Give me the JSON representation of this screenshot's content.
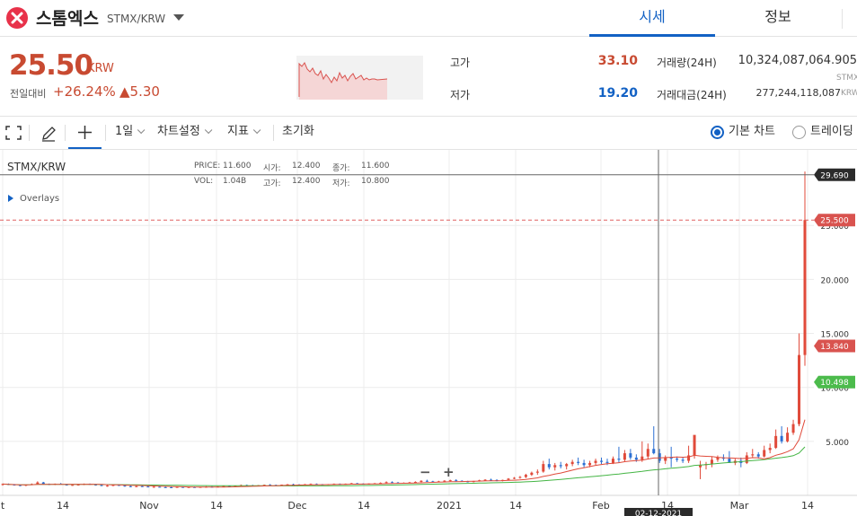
{
  "header": {
    "coin_name": "스톰엑스",
    "pair": "STMX/KRW",
    "logo_icon": "stormx-x-logo",
    "tabs": [
      {
        "label": "시세",
        "active": true
      },
      {
        "label": "정보",
        "active": false
      }
    ]
  },
  "ticker": {
    "price": "25.50",
    "unit": "KRW",
    "change_label": "전일대비",
    "change_rate": "+26.24%",
    "change_amount": "▲5.30",
    "high_label": "고가",
    "high": "33.10",
    "low_label": "저가",
    "low": "19.20",
    "volume_label": "거래량(24H)",
    "volume": "10,324,087,064.905",
    "volume_unit": "STMX",
    "value_label": "거래대금(24H)",
    "value": "277,244,118,087",
    "value_unit": "KRW",
    "up_color": "#c84a31",
    "down_color": "#1261c4"
  },
  "toolbar": {
    "period": "1일",
    "chart_settings": "차트설정",
    "indicators": "지표",
    "reset": "초기화",
    "basic_chart": "기본 차트",
    "trading_view": "트레이딩"
  },
  "legend": {
    "pair": "STMX/KRW",
    "overlays": "Overlays",
    "price_label": "PRICE:",
    "price": "11.600",
    "open_label": "시가:",
    "open": "12.400",
    "close_label": "종가:",
    "close": "11.600",
    "vol_label": "VOL:",
    "vol": "1.04B",
    "high_label": "고가:",
    "high": "12.400",
    "low_label": "저가:",
    "low": "10.800"
  },
  "chart_data": {
    "type": "candlestick",
    "x_ticks": [
      "t",
      "14",
      "Nov",
      "14",
      "Dec",
      "14",
      "2021",
      "14",
      "Feb",
      "14",
      "Mar",
      "14"
    ],
    "y_ticks": [
      "5.000",
      "10.000",
      "15.000",
      "20.000",
      "25.000"
    ],
    "y_range": [
      0,
      32
    ],
    "crosshair_price": "29.690",
    "crosshair_date": "02-12-2021",
    "last_price": "25.500",
    "ma_short_value": "13.840",
    "ma_long_value": "10.498",
    "ma_short_color": "#e04a3a",
    "ma_long_color": "#44b544",
    "up_color": "#e04a3a",
    "down_color": "#2b6fd3",
    "candles": [
      [
        1.0,
        1.1,
        0.9,
        1.05
      ],
      [
        1.05,
        1.1,
        0.95,
        1.0
      ],
      [
        1.0,
        1.05,
        0.9,
        0.95
      ],
      [
        0.95,
        1.0,
        0.85,
        0.9
      ],
      [
        0.9,
        1.0,
        0.85,
        0.98
      ],
      [
        0.98,
        1.1,
        0.95,
        1.05
      ],
      [
        1.05,
        1.3,
        1.0,
        1.2
      ],
      [
        1.2,
        1.25,
        1.0,
        1.05
      ],
      [
        1.05,
        1.1,
        0.95,
        1.0
      ],
      [
        1.0,
        1.1,
        0.95,
        1.08
      ],
      [
        1.08,
        1.15,
        1.0,
        1.02
      ],
      [
        1.02,
        1.05,
        0.9,
        0.92
      ],
      [
        0.92,
        1.0,
        0.88,
        0.97
      ],
      [
        0.97,
        1.05,
        0.9,
        1.0
      ],
      [
        1.0,
        1.1,
        0.95,
        1.06
      ],
      [
        1.06,
        1.1,
        0.98,
        1.0
      ],
      [
        1.0,
        1.05,
        0.9,
        0.95
      ],
      [
        0.95,
        1.0,
        0.85,
        0.88
      ],
      [
        0.88,
        0.95,
        0.8,
        0.9
      ],
      [
        0.9,
        1.0,
        0.85,
        0.96
      ],
      [
        0.96,
        1.0,
        0.88,
        0.9
      ],
      [
        0.9,
        0.95,
        0.8,
        0.85
      ],
      [
        0.85,
        0.9,
        0.75,
        0.8
      ],
      [
        0.8,
        0.88,
        0.75,
        0.85
      ],
      [
        0.85,
        0.9,
        0.78,
        0.82
      ],
      [
        0.82,
        0.88,
        0.75,
        0.78
      ],
      [
        0.78,
        0.85,
        0.7,
        0.8
      ],
      [
        0.8,
        0.86,
        0.74,
        0.76
      ],
      [
        0.76,
        0.82,
        0.7,
        0.75
      ],
      [
        0.75,
        0.8,
        0.68,
        0.72
      ],
      [
        0.72,
        0.8,
        0.7,
        0.78
      ],
      [
        0.78,
        0.82,
        0.7,
        0.74
      ],
      [
        0.74,
        0.8,
        0.7,
        0.77
      ],
      [
        0.77,
        0.82,
        0.72,
        0.75
      ],
      [
        0.75,
        0.8,
        0.7,
        0.78
      ],
      [
        0.78,
        0.85,
        0.74,
        0.8
      ],
      [
        0.8,
        0.86,
        0.76,
        0.78
      ],
      [
        0.78,
        0.84,
        0.74,
        0.82
      ],
      [
        0.82,
        0.9,
        0.8,
        0.86
      ],
      [
        0.86,
        0.9,
        0.8,
        0.84
      ],
      [
        0.84,
        0.9,
        0.8,
        0.88
      ],
      [
        0.88,
        1.0,
        0.85,
        0.95
      ],
      [
        0.95,
        1.0,
        0.88,
        0.92
      ],
      [
        0.92,
        0.98,
        0.86,
        0.9
      ],
      [
        0.9,
        0.96,
        0.85,
        0.94
      ],
      [
        0.94,
        1.0,
        0.9,
        0.98
      ],
      [
        0.98,
        1.05,
        0.92,
        0.96
      ],
      [
        0.96,
        1.0,
        0.9,
        0.94
      ],
      [
        0.94,
        1.0,
        0.9,
        0.99
      ],
      [
        0.99,
        1.05,
        0.95,
        1.02
      ],
      [
        1.02,
        1.08,
        0.98,
        1.0
      ],
      [
        1.0,
        1.05,
        0.95,
        0.98
      ],
      [
        0.98,
        1.05,
        0.95,
        1.03
      ],
      [
        1.03,
        1.1,
        1.0,
        1.06
      ],
      [
        1.06,
        1.1,
        1.0,
        1.02
      ],
      [
        1.02,
        1.05,
        0.95,
        0.98
      ],
      [
        0.98,
        1.05,
        0.95,
        1.03
      ],
      [
        1.03,
        1.1,
        1.0,
        1.07
      ],
      [
        1.07,
        1.1,
        1.0,
        1.04
      ],
      [
        1.04,
        1.1,
        1.0,
        1.08
      ],
      [
        1.08,
        1.15,
        1.05,
        1.12
      ],
      [
        1.12,
        1.15,
        1.05,
        1.08
      ],
      [
        1.08,
        1.12,
        1.0,
        1.04
      ],
      [
        1.04,
        1.1,
        1.0,
        1.09
      ],
      [
        1.09,
        1.15,
        1.05,
        1.12
      ],
      [
        1.12,
        1.2,
        1.08,
        1.16
      ],
      [
        1.16,
        1.3,
        1.1,
        1.22
      ],
      [
        1.22,
        1.3,
        1.15,
        1.18
      ],
      [
        1.18,
        1.25,
        1.1,
        1.14
      ],
      [
        1.14,
        1.2,
        1.1,
        1.17
      ],
      [
        1.17,
        1.25,
        1.12,
        1.2
      ],
      [
        1.2,
        1.3,
        1.15,
        1.25
      ],
      [
        1.25,
        1.4,
        1.2,
        1.35
      ],
      [
        1.35,
        1.45,
        1.25,
        1.3
      ],
      [
        1.3,
        1.35,
        1.2,
        1.26
      ],
      [
        1.26,
        1.35,
        1.2,
        1.3
      ],
      [
        1.3,
        1.4,
        1.25,
        1.36
      ],
      [
        1.36,
        1.45,
        1.3,
        1.4
      ],
      [
        1.4,
        1.5,
        1.3,
        1.35
      ],
      [
        1.35,
        1.4,
        1.25,
        1.3
      ],
      [
        1.3,
        1.35,
        1.2,
        1.28
      ],
      [
        1.28,
        1.35,
        1.2,
        1.32
      ],
      [
        1.32,
        1.45,
        1.28,
        1.4
      ],
      [
        1.4,
        1.5,
        1.35,
        1.45
      ],
      [
        1.45,
        1.55,
        1.35,
        1.42
      ],
      [
        1.42,
        1.5,
        1.3,
        1.38
      ],
      [
        1.38,
        1.45,
        1.3,
        1.43
      ],
      [
        1.43,
        1.6,
        1.4,
        1.55
      ],
      [
        1.55,
        1.7,
        1.5,
        1.62
      ],
      [
        1.62,
        1.8,
        1.55,
        1.7
      ],
      [
        1.7,
        2.0,
        1.6,
        1.9
      ],
      [
        1.9,
        2.2,
        1.8,
        2.1
      ],
      [
        2.1,
        2.4,
        1.9,
        2.2
      ],
      [
        2.2,
        3.2,
        2.1,
        2.9
      ],
      [
        2.9,
        3.4,
        2.4,
        2.6
      ],
      [
        2.6,
        3.0,
        2.3,
        2.8
      ],
      [
        2.8,
        3.1,
        2.5,
        2.7
      ],
      [
        2.7,
        3.0,
        2.4,
        2.9
      ],
      [
        2.9,
        3.3,
        2.7,
        3.1
      ],
      [
        3.1,
        3.5,
        2.8,
        3.0
      ],
      [
        3.0,
        3.3,
        2.6,
        2.8
      ],
      [
        2.8,
        3.2,
        2.6,
        3.0
      ],
      [
        3.0,
        3.4,
        2.8,
        3.2
      ],
      [
        3.2,
        3.5,
        2.9,
        3.1
      ],
      [
        3.1,
        3.4,
        2.8,
        3.0
      ],
      [
        3.0,
        3.6,
        2.9,
        3.4
      ],
      [
        3.4,
        4.5,
        3.0,
        3.3
      ],
      [
        3.3,
        4.2,
        3.1,
        3.9
      ],
      [
        3.9,
        4.3,
        3.3,
        3.5
      ],
      [
        3.5,
        3.8,
        3.1,
        3.3
      ],
      [
        3.3,
        5.0,
        3.1,
        3.6
      ],
      [
        3.6,
        4.8,
        3.4,
        4.3
      ],
      [
        4.3,
        6.4,
        3.8,
        3.9
      ],
      [
        3.9,
        4.3,
        3.0,
        3.2
      ],
      [
        3.2,
        3.7,
        2.9,
        3.5
      ],
      [
        3.5,
        4.5,
        2.6,
        3.4
      ],
      [
        3.4,
        3.6,
        3.1,
        3.3
      ],
      [
        3.3,
        3.5,
        3.0,
        3.2
      ],
      [
        3.2,
        4.6,
        3.0,
        3.7
      ],
      [
        3.7,
        5.1,
        3.4,
        5.6
      ],
      [
        2.6,
        3.2,
        1.5,
        2.8
      ],
      [
        2.8,
        3.1,
        2.4,
        2.9
      ],
      [
        2.9,
        3.6,
        2.6,
        3.3
      ],
      [
        3.3,
        3.7,
        3.1,
        3.5
      ],
      [
        3.5,
        3.8,
        3.2,
        3.4
      ],
      [
        3.4,
        4.1,
        3.1,
        3.0
      ],
      [
        3.0,
        3.4,
        2.8,
        3.2
      ],
      [
        3.2,
        3.5,
        2.6,
        3.0
      ],
      [
        3.0,
        4.0,
        2.9,
        3.7
      ],
      [
        3.7,
        4.3,
        3.5,
        3.8
      ],
      [
        3.8,
        4.0,
        3.4,
        3.6
      ],
      [
        3.6,
        4.6,
        3.5,
        4.2
      ],
      [
        4.2,
        4.8,
        3.9,
        4.4
      ],
      [
        4.4,
        6.1,
        4.3,
        5.5
      ],
      [
        5.5,
        6.4,
        4.8,
        5.0
      ],
      [
        5.0,
        6.3,
        4.9,
        5.8
      ],
      [
        5.8,
        7.0,
        5.6,
        6.6
      ],
      [
        6.6,
        15.0,
        6.4,
        13.0
      ],
      [
        13.0,
        30.0,
        12.0,
        25.5
      ]
    ]
  }
}
